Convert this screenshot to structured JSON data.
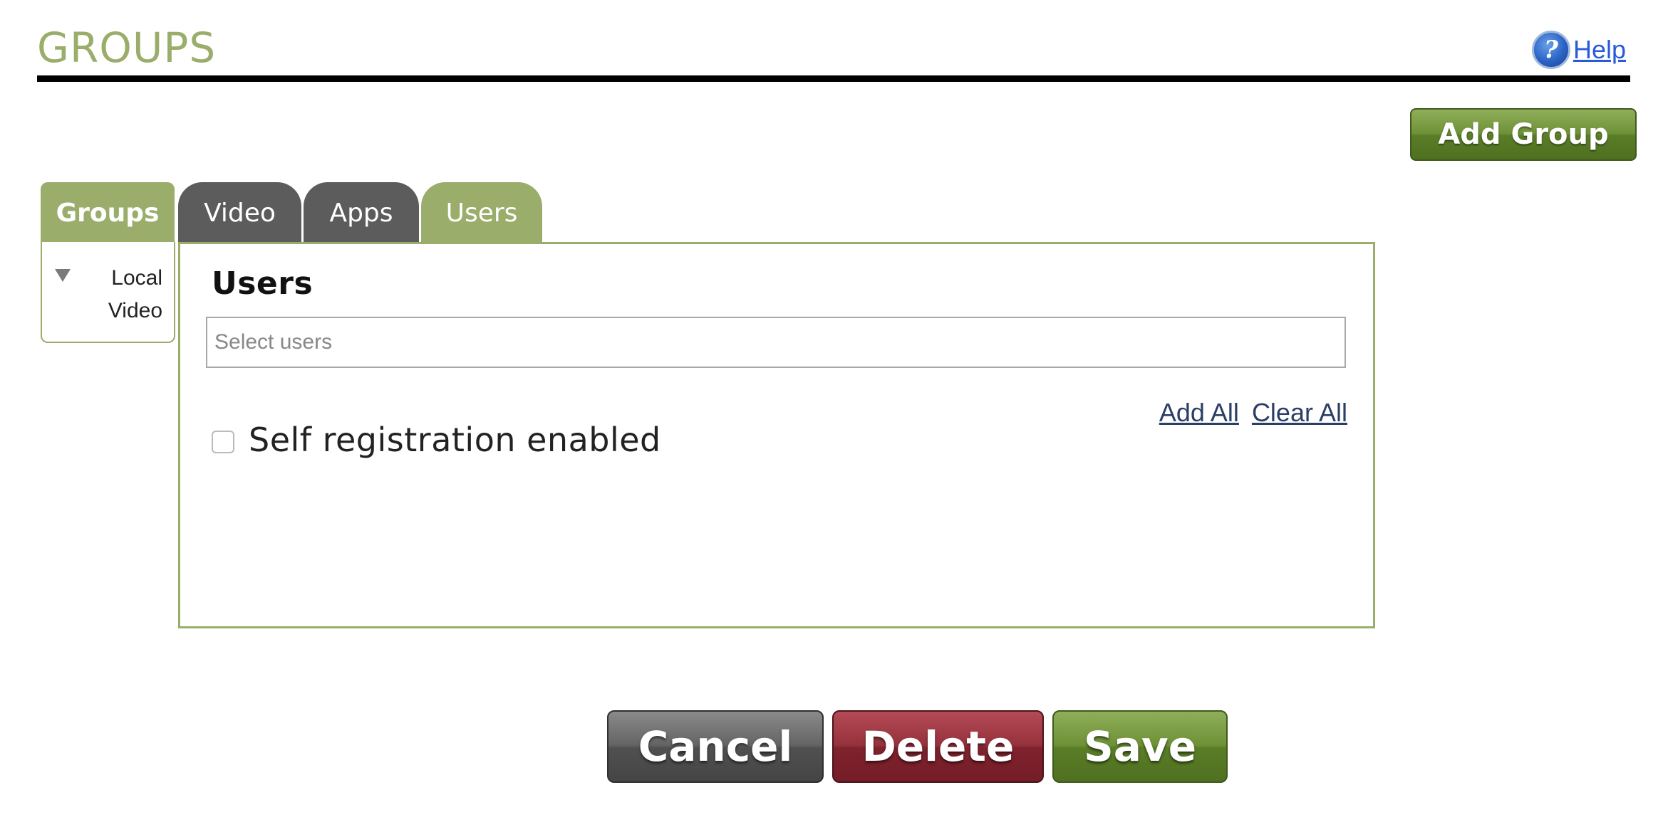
{
  "header": {
    "title": "GROUPS",
    "help_label": "Help",
    "help_icon": "help-question-icon"
  },
  "toolbar": {
    "add_group_label": "Add Group"
  },
  "sidebar": {
    "tab_label": "Groups",
    "tree": [
      {
        "label": "Local Video",
        "expanded": true
      }
    ]
  },
  "tabs": [
    {
      "label": "Video",
      "active": false
    },
    {
      "label": "Apps",
      "active": false
    },
    {
      "label": "Users",
      "active": true
    }
  ],
  "panel": {
    "title": "Users",
    "users_input": {
      "placeholder": "Select users",
      "value": ""
    },
    "add_all_label": "Add All",
    "clear_all_label": "Clear All",
    "self_registration": {
      "label": "Self registration enabled",
      "checked": false
    }
  },
  "actions": {
    "cancel_label": "Cancel",
    "delete_label": "Delete",
    "save_label": "Save"
  },
  "colors": {
    "accent_green": "#9aad6a",
    "tab_inactive": "#5c5c5c",
    "delete_red": "#96323d",
    "link_blue": "#2a5bd7"
  }
}
